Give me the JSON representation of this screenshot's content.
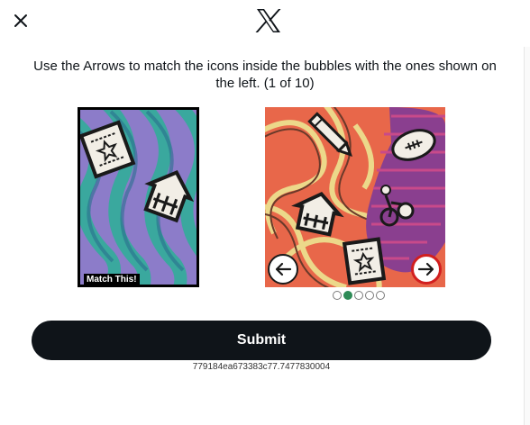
{
  "header": {
    "close_icon": "close-icon",
    "logo_icon": "x-logo-icon"
  },
  "challenge": {
    "instruction_text": "Use the Arrows to match the icons inside the bubbles with the ones shown on the left. (1 of 10)",
    "target_label": "Match This!",
    "target_icons": [
      "note-paper-icon",
      "house-icon"
    ],
    "puzzle_icons": [
      "pencil-icon",
      "american-football-icon",
      "house-icon",
      "cyclist-icon",
      "note-paper-icon"
    ],
    "left_arrow_icon": "arrow-left-icon",
    "right_arrow_icon": "arrow-right-icon",
    "pagination": {
      "total": 5,
      "active_index": 1
    }
  },
  "submit": {
    "label": "Submit"
  },
  "session": {
    "id_text": "779184ea673383c77.7477830004"
  },
  "colors": {
    "button_bg": "#0f1419",
    "right_arrow_border": "#d21f1f",
    "active_dot": "#2e8b57"
  }
}
